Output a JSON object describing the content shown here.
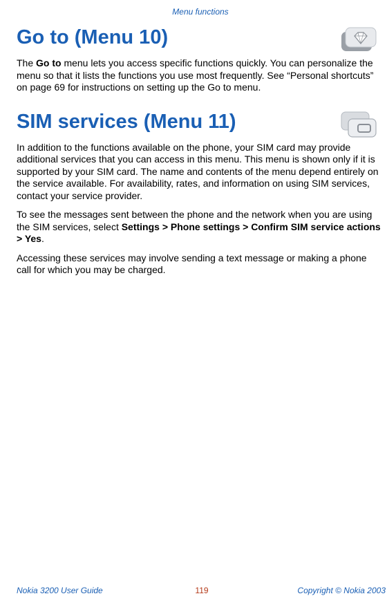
{
  "header": {
    "label": "Menu functions"
  },
  "section_goto": {
    "title": "Go to (Menu 10)",
    "body": "The Go to menu lets you access specific functions quickly. You can personalize the menu so that it lists the functions you use most frequently. See “Personal shortcuts” on page 69 for instructions on setting up the Go to menu.",
    "bold_lead": "Go to"
  },
  "section_sim": {
    "title": "SIM services (Menu 11)",
    "para1": "In addition to the functions available on the phone, your SIM card may provide additional services that you can access in this menu. This menu is shown only if it is supported by your SIM card. The name and contents of the menu depend entirely on the service available. For availability, rates, and information on using SIM services, contact your service provider.",
    "para2_pre": "To see the messages sent between the phone and the network when you are using the SIM services, select ",
    "para2_bold": "Settings > Phone settings > Confirm SIM service actions > Yes",
    "para2_post": ".",
    "para3": "Accessing these services may involve sending a text message or making a phone call for which you may be charged."
  },
  "footer": {
    "left": "Nokia 3200 User Guide",
    "center": "119",
    "right": "Copyright © Nokia 2003"
  }
}
